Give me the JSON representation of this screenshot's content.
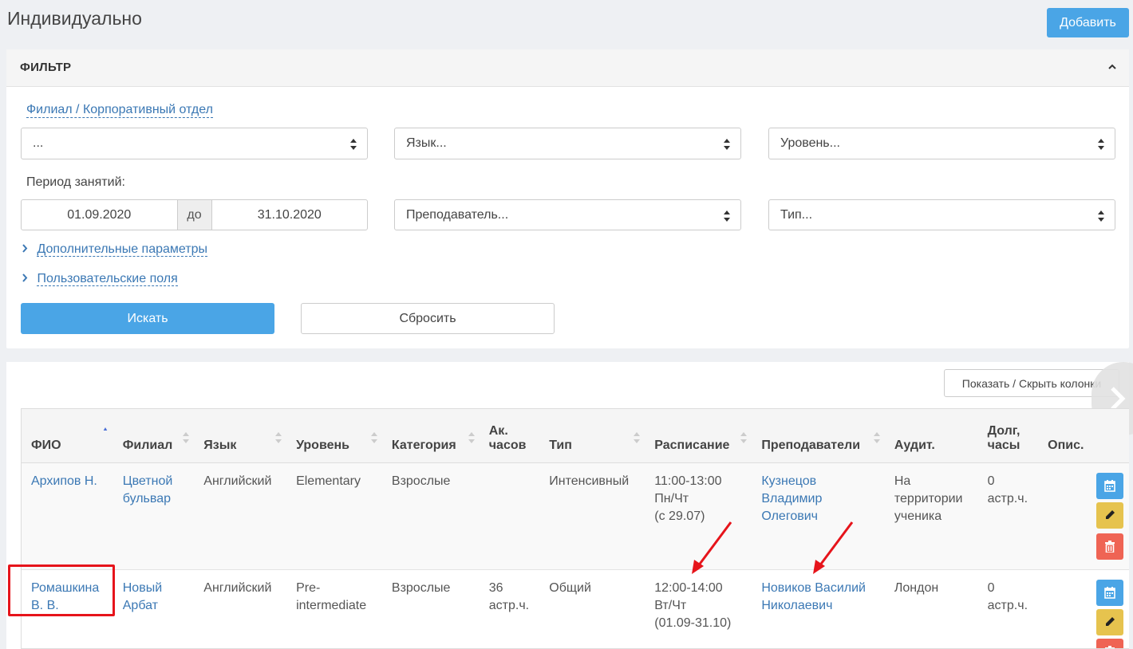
{
  "page": {
    "title": "Индивидуально",
    "add_label": "Добавить"
  },
  "filter": {
    "title": "ФИЛЬТР",
    "branch_link": "Филиал / Корпоративный отдел",
    "branch_value": "...",
    "language_placeholder": "Язык...",
    "level_placeholder": "Уровень...",
    "period_label": "Период занятий:",
    "date_from": "01.09.2020",
    "date_to_label": "до",
    "date_to": "31.10.2020",
    "teacher_placeholder": "Преподаватель...",
    "type_placeholder": "Тип...",
    "extra_params": "Дополнительные параметры",
    "custom_fields": "Пользовательские поля",
    "search_label": "Искать",
    "reset_label": "Сбросить"
  },
  "results": {
    "columns_button": "Показать / Скрыть колонки",
    "headers": {
      "fio": "ФИО",
      "branch": "Филиал",
      "language": "Язык",
      "level": "Уровень",
      "category": "Категория",
      "hours_1": "Ак.",
      "hours_2": "часов",
      "type": "Тип",
      "schedule": "Расписание",
      "teachers": "Преподаватели",
      "room": "Аудит.",
      "debt_1": "Долг,",
      "debt_2": "часы",
      "desc": "Опис."
    },
    "rows": [
      {
        "fio": "Архипов Н.",
        "branch_1": "Цветной",
        "branch_2": "бульвар",
        "language": "Английский",
        "level_1": "Elementary",
        "level_2": "",
        "category": "Взрослые",
        "hours_1": "",
        "hours_2": "",
        "type": "Интенсивный",
        "sched_1": "11:00-13:00",
        "sched_2": "Пн/Чт",
        "sched_3": "(с 29.07)",
        "teacher_1": "Кузнецов",
        "teacher_2": "Владимир",
        "teacher_3": "Олегович",
        "room_1": "На",
        "room_2": "территории",
        "room_3": "ученика",
        "debt_1": "0",
        "debt_2": "астр.ч."
      },
      {
        "fio_1": "Ромашкина",
        "fio_2": "В. В.",
        "branch_1": "Новый",
        "branch_2": "Арбат",
        "language": "Английский",
        "level_1": "Pre-",
        "level_2": "intermediate",
        "category": "Взрослые",
        "hours_1": "36",
        "hours_2": "астр.ч.",
        "type": "Общий",
        "sched_1": "12:00-14:00",
        "sched_2": "Вт/Чт",
        "sched_3": "(01.09-31.10)",
        "teacher_1": "Новиков Василий",
        "teacher_2": "Николаевич",
        "room": "Лондон",
        "debt_1": "0",
        "debt_2": "астр.ч."
      }
    ]
  },
  "colors": {
    "accent": "#4aa5e6",
    "link": "#3b78b4",
    "highlight": "#e6141b"
  }
}
